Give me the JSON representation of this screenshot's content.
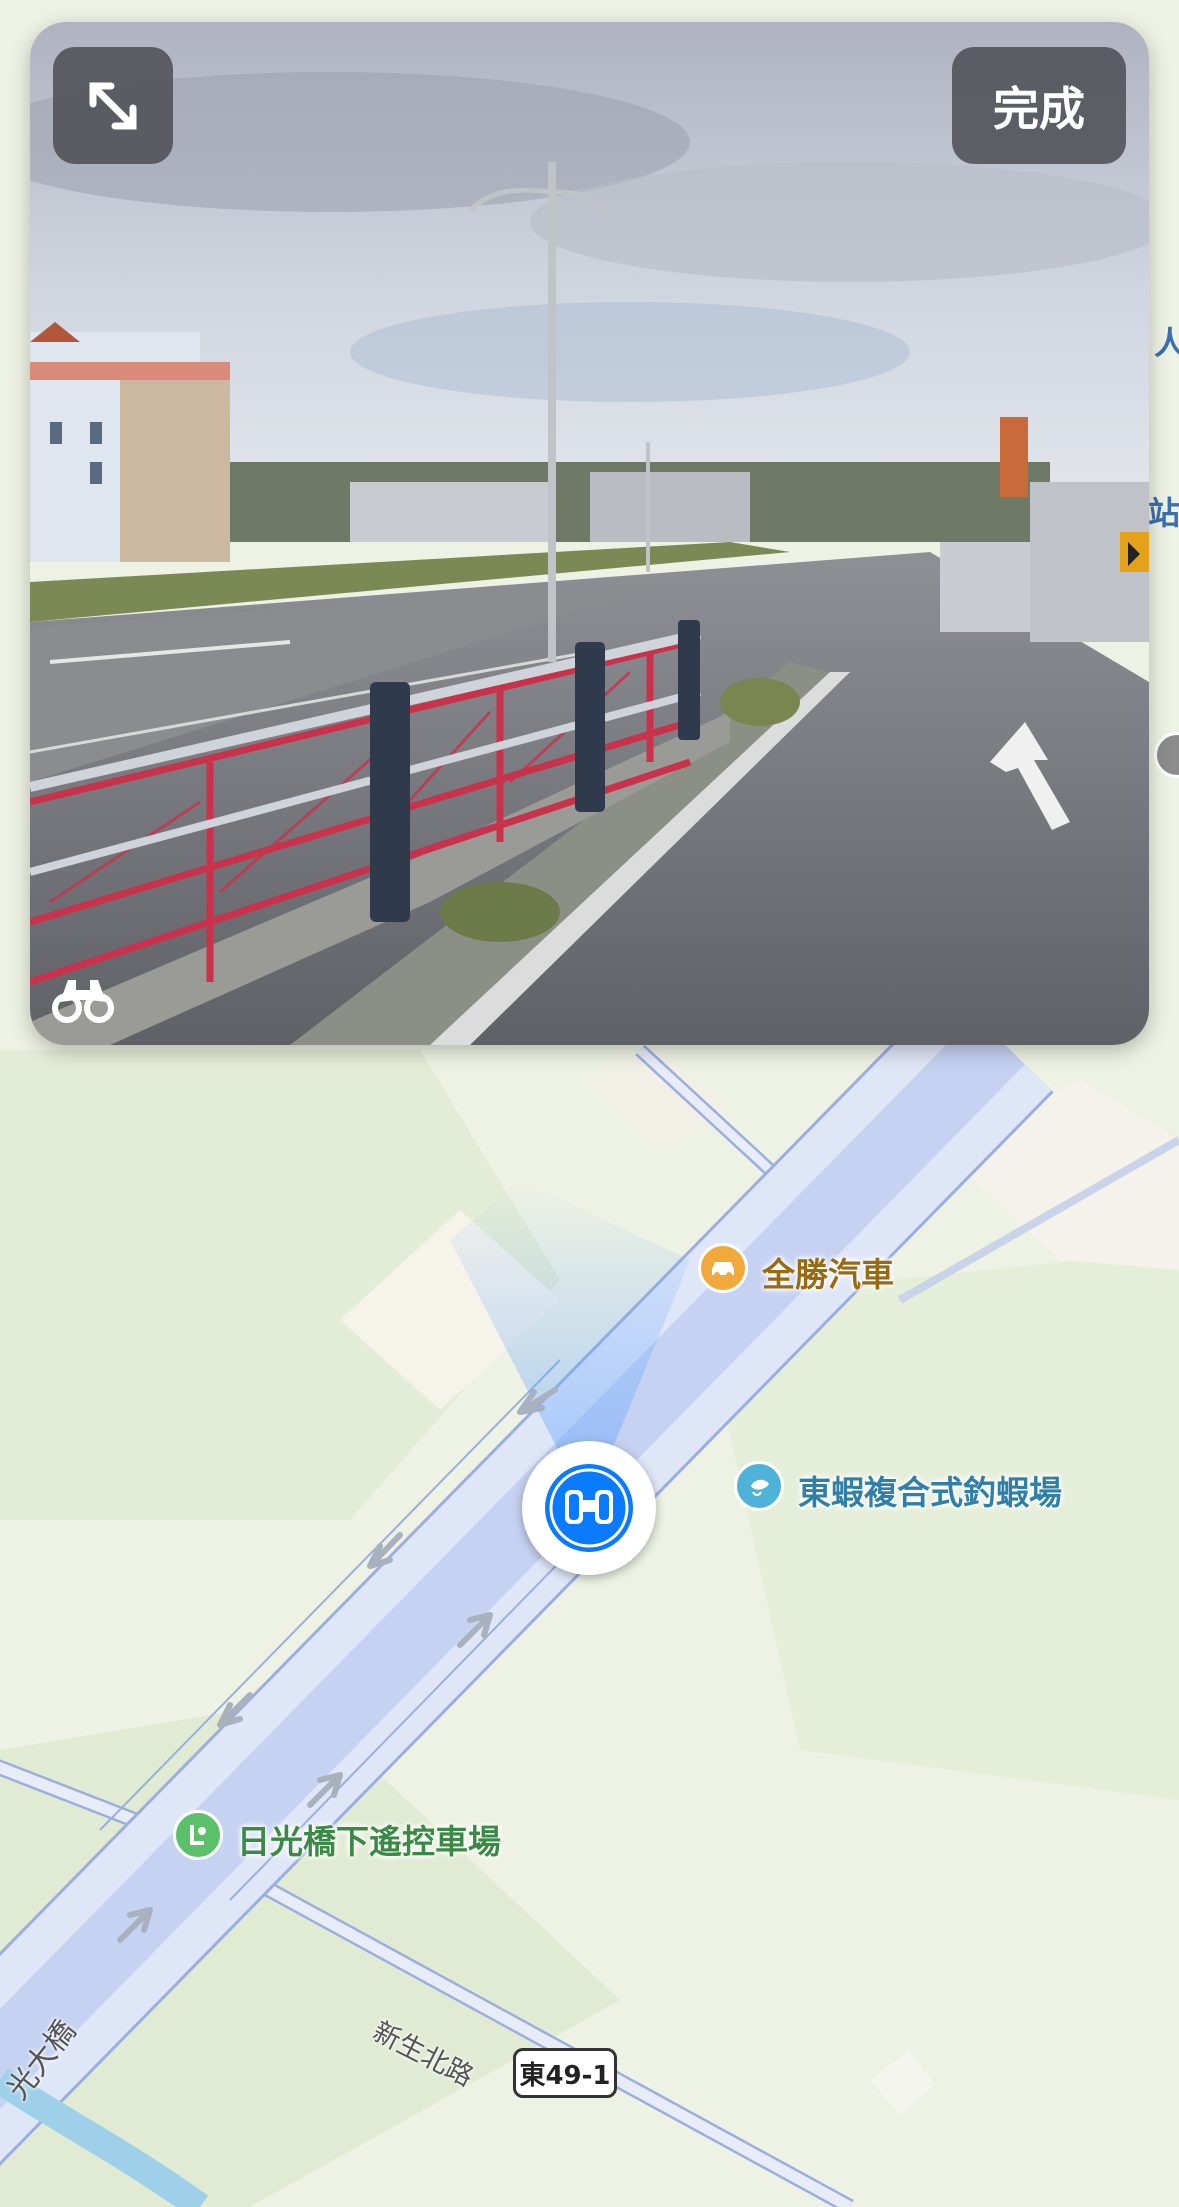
{
  "viewer": {
    "done_label": "完成",
    "expand_icon": "expand-arrows-icon",
    "binoculars_icon": "binoculars-icon"
  },
  "map": {
    "pois": [
      {
        "name": "全勝汽車",
        "icon": "car-icon",
        "color": "#f2a93b",
        "text_color": "#9a6a12"
      },
      {
        "name": "東蝦複合式釣蝦場",
        "icon": "fishing-icon",
        "color": "#4fb3d9",
        "text_color": "#2f7fa8"
      },
      {
        "name": "日光橋下遙控車場",
        "icon": "park-icon",
        "color": "#5cbf6a",
        "text_color": "#3a8a45"
      }
    ],
    "roads": {
      "xinsheng": "新生北路",
      "bridge": "光大橋",
      "route_shield": "東49-1"
    },
    "edge_labels": [
      "人",
      "站"
    ],
    "look_around_icon": "look-around-binoculars-icon"
  },
  "colors": {
    "accent": "#0a7aff",
    "map_bg": "#eef2e4",
    "road": "#dfe6f8",
    "road_edge": "#9aaee0"
  }
}
